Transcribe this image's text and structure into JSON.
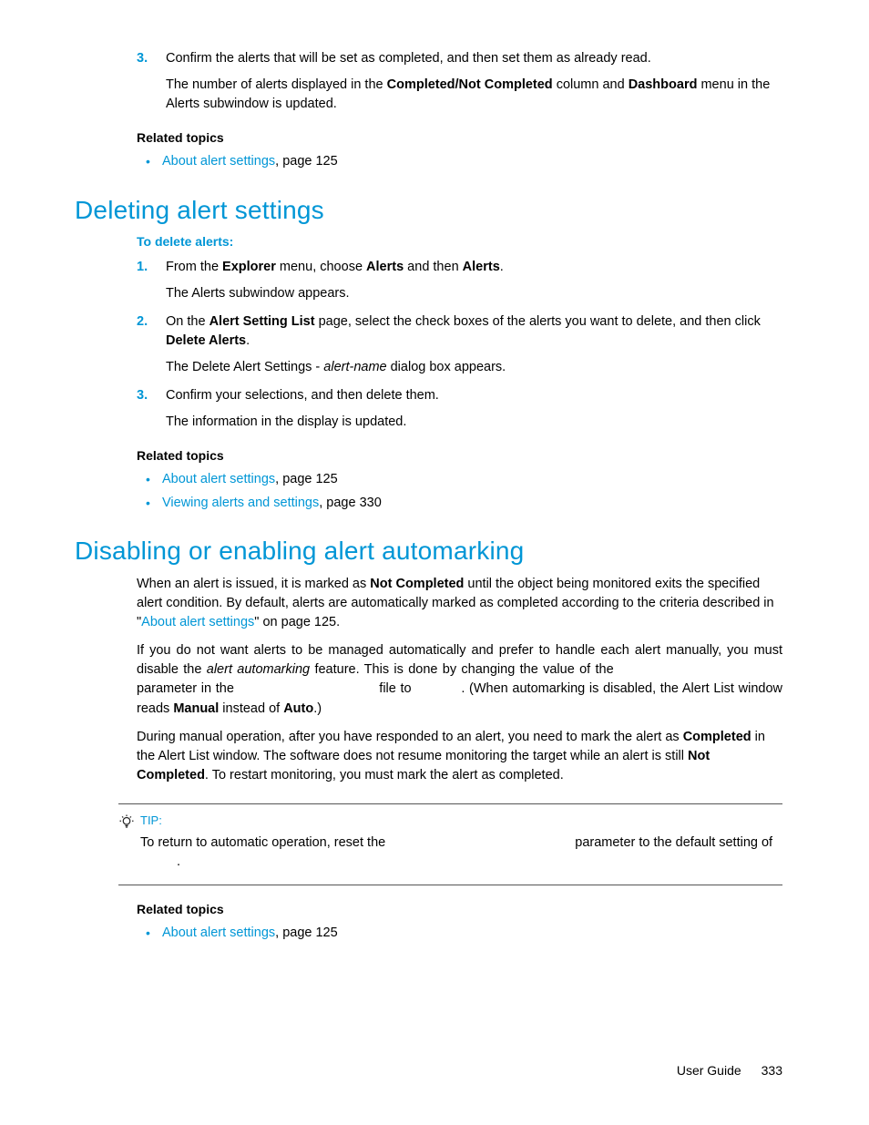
{
  "top": {
    "step3_a": "Confirm the alerts that will be set as completed, and then set them as already read.",
    "step3_b_pre": "The number of alerts displayed in the ",
    "step3_b_b1": "Completed/Not Completed",
    "step3_b_mid": " column and ",
    "step3_b_b2": "Dashboard",
    "step3_b_post": " menu in the Alerts subwindow is updated."
  },
  "related1": {
    "heading": "Related topics",
    "item1_link": "About alert settings",
    "item1_page": ", page 125"
  },
  "deleting": {
    "heading": "Deleting alert settings",
    "proc": "To delete alerts:",
    "s1_pre": "From the ",
    "s1_b1": "Explorer",
    "s1_mid": " menu, choose ",
    "s1_b2": "Alerts",
    "s1_mid2": " and then ",
    "s1_b3": "Alerts",
    "s1_post": ".",
    "s1_sub": "The Alerts subwindow appears.",
    "s2_pre": "On the ",
    "s2_b1": "Alert Setting List",
    "s2_mid": " page, select the check boxes of the alerts you want to delete, and then click ",
    "s2_b2": "Delete Alerts",
    "s2_post": ".",
    "s2_sub_pre": "The Delete Alert Settings - ",
    "s2_sub_i": "alert-name",
    "s2_sub_post": " dialog box appears.",
    "s3": "Confirm your selections, and then delete them.",
    "s3_sub": "The information in the display is updated."
  },
  "related2": {
    "heading": "Related topics",
    "item1_link": "About alert settings",
    "item1_page": ", page 125",
    "item2_link": "Viewing alerts and settings",
    "item2_page": ", page 330"
  },
  "disabling": {
    "heading": "Disabling or enabling alert automarking",
    "p1_pre": "When an alert is issued, it is marked as ",
    "p1_b1": "Not Completed",
    "p1_mid": " until the object being monitored exits the specified alert condition. By default, alerts are automatically marked as completed according to the criteria described in \"",
    "p1_link": "About alert settings",
    "p1_post": "\" on page 125.",
    "p2_pre": "If you do not want alerts to be managed automatically and prefer to handle each alert manually, you must disable the ",
    "p2_i": "alert automarking",
    "p2_mid1": " feature. This is done by changing the value of the ",
    "p2_mid2": " parameter in the ",
    "p2_mid3": " file to ",
    "p2_mid4": ". (When automarking is disabled, the Alert List window reads ",
    "p2_b1": "Manual",
    "p2_mid5": " instead of ",
    "p2_b2": "Auto",
    "p2_post": ".)",
    "p3_pre": "During manual operation, after you have responded to an alert, you need to mark the alert as ",
    "p3_b1": "Completed",
    "p3_mid": " in the Alert List window. The software does not resume monitoring the target while an alert is still ",
    "p3_b2": "Not Completed",
    "p3_post": ". To restart monitoring, you must mark the alert as completed."
  },
  "tip": {
    "label": "TIP:",
    "text_pre": "To return to automatic operation, reset the ",
    "text_mid": " parameter to the default setting of ",
    "text_post": "."
  },
  "related3": {
    "heading": "Related topics",
    "item1_link": "About alert settings",
    "item1_page": ", page 125"
  },
  "footer": {
    "label": "User Guide",
    "page": "333"
  },
  "nums": {
    "n1": "1.",
    "n2": "2.",
    "n3": "3."
  }
}
